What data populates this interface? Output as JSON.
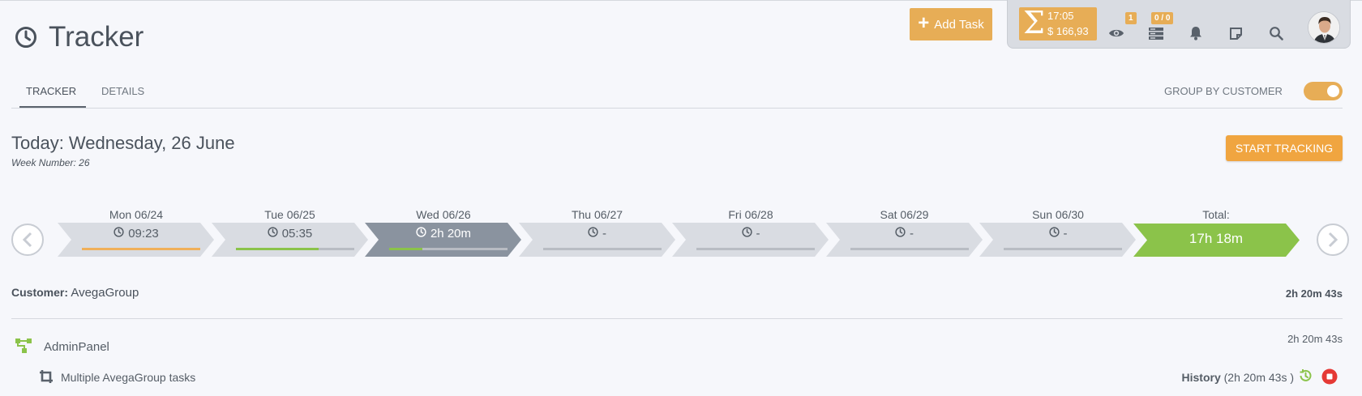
{
  "header": {
    "title": "Tracker",
    "add_task_label": "Add Task"
  },
  "topbar": {
    "time": "17:05",
    "money": "$ 166,93",
    "watch_badge": "1",
    "tasks_badge": "0 / 0",
    "icons": [
      "eye-icon",
      "server-icon",
      "bell-icon",
      "note-icon",
      "search-icon"
    ]
  },
  "tabs": [
    {
      "label": "TRACKER",
      "active": true
    },
    {
      "label": "DETAILS",
      "active": false
    }
  ],
  "group_by": {
    "label": "GROUP BY CUSTOMER",
    "enabled": true
  },
  "today": {
    "title": "Today: Wednesday, 26 June",
    "week": "Week Number: 26",
    "start_label": "START TRACKING"
  },
  "week": {
    "days": [
      {
        "label": "Mon 06/24",
        "value": "09:23",
        "progress": 1.0,
        "color": "#f0b05a"
      },
      {
        "label": "Tue 06/25",
        "value": "05:35",
        "progress": 0.7,
        "color": "#8bc34a"
      },
      {
        "label": "Wed 06/26",
        "value": "2h 20m",
        "progress": 0.28,
        "color": "#8bc34a",
        "active": true
      },
      {
        "label": "Thu 06/27",
        "value": "-",
        "progress": 0
      },
      {
        "label": "Fri 06/28",
        "value": "-",
        "progress": 0
      },
      {
        "label": "Sat 06/29",
        "value": "-",
        "progress": 0
      },
      {
        "label": "Sun 06/30",
        "value": "-",
        "progress": 0
      }
    ],
    "total_label": "Total:",
    "total_value": "17h 18m"
  },
  "customer": {
    "label": "Customer:",
    "name": "AvegaGroup",
    "total": "2h 20m 43s"
  },
  "project": {
    "name": "AdminPanel",
    "total": "2h 20m 43s"
  },
  "task": {
    "name": "Multiple AvegaGroup tasks",
    "history_label": "History",
    "history_value": "(2h 20m 43s )"
  },
  "colors": {
    "accent": "#e7ad56",
    "start_button": "#f0a540",
    "active_day": "#8a939f",
    "inactive_day": "#d9dce2",
    "total": "#8bc34a",
    "stop": "#e53935"
  }
}
